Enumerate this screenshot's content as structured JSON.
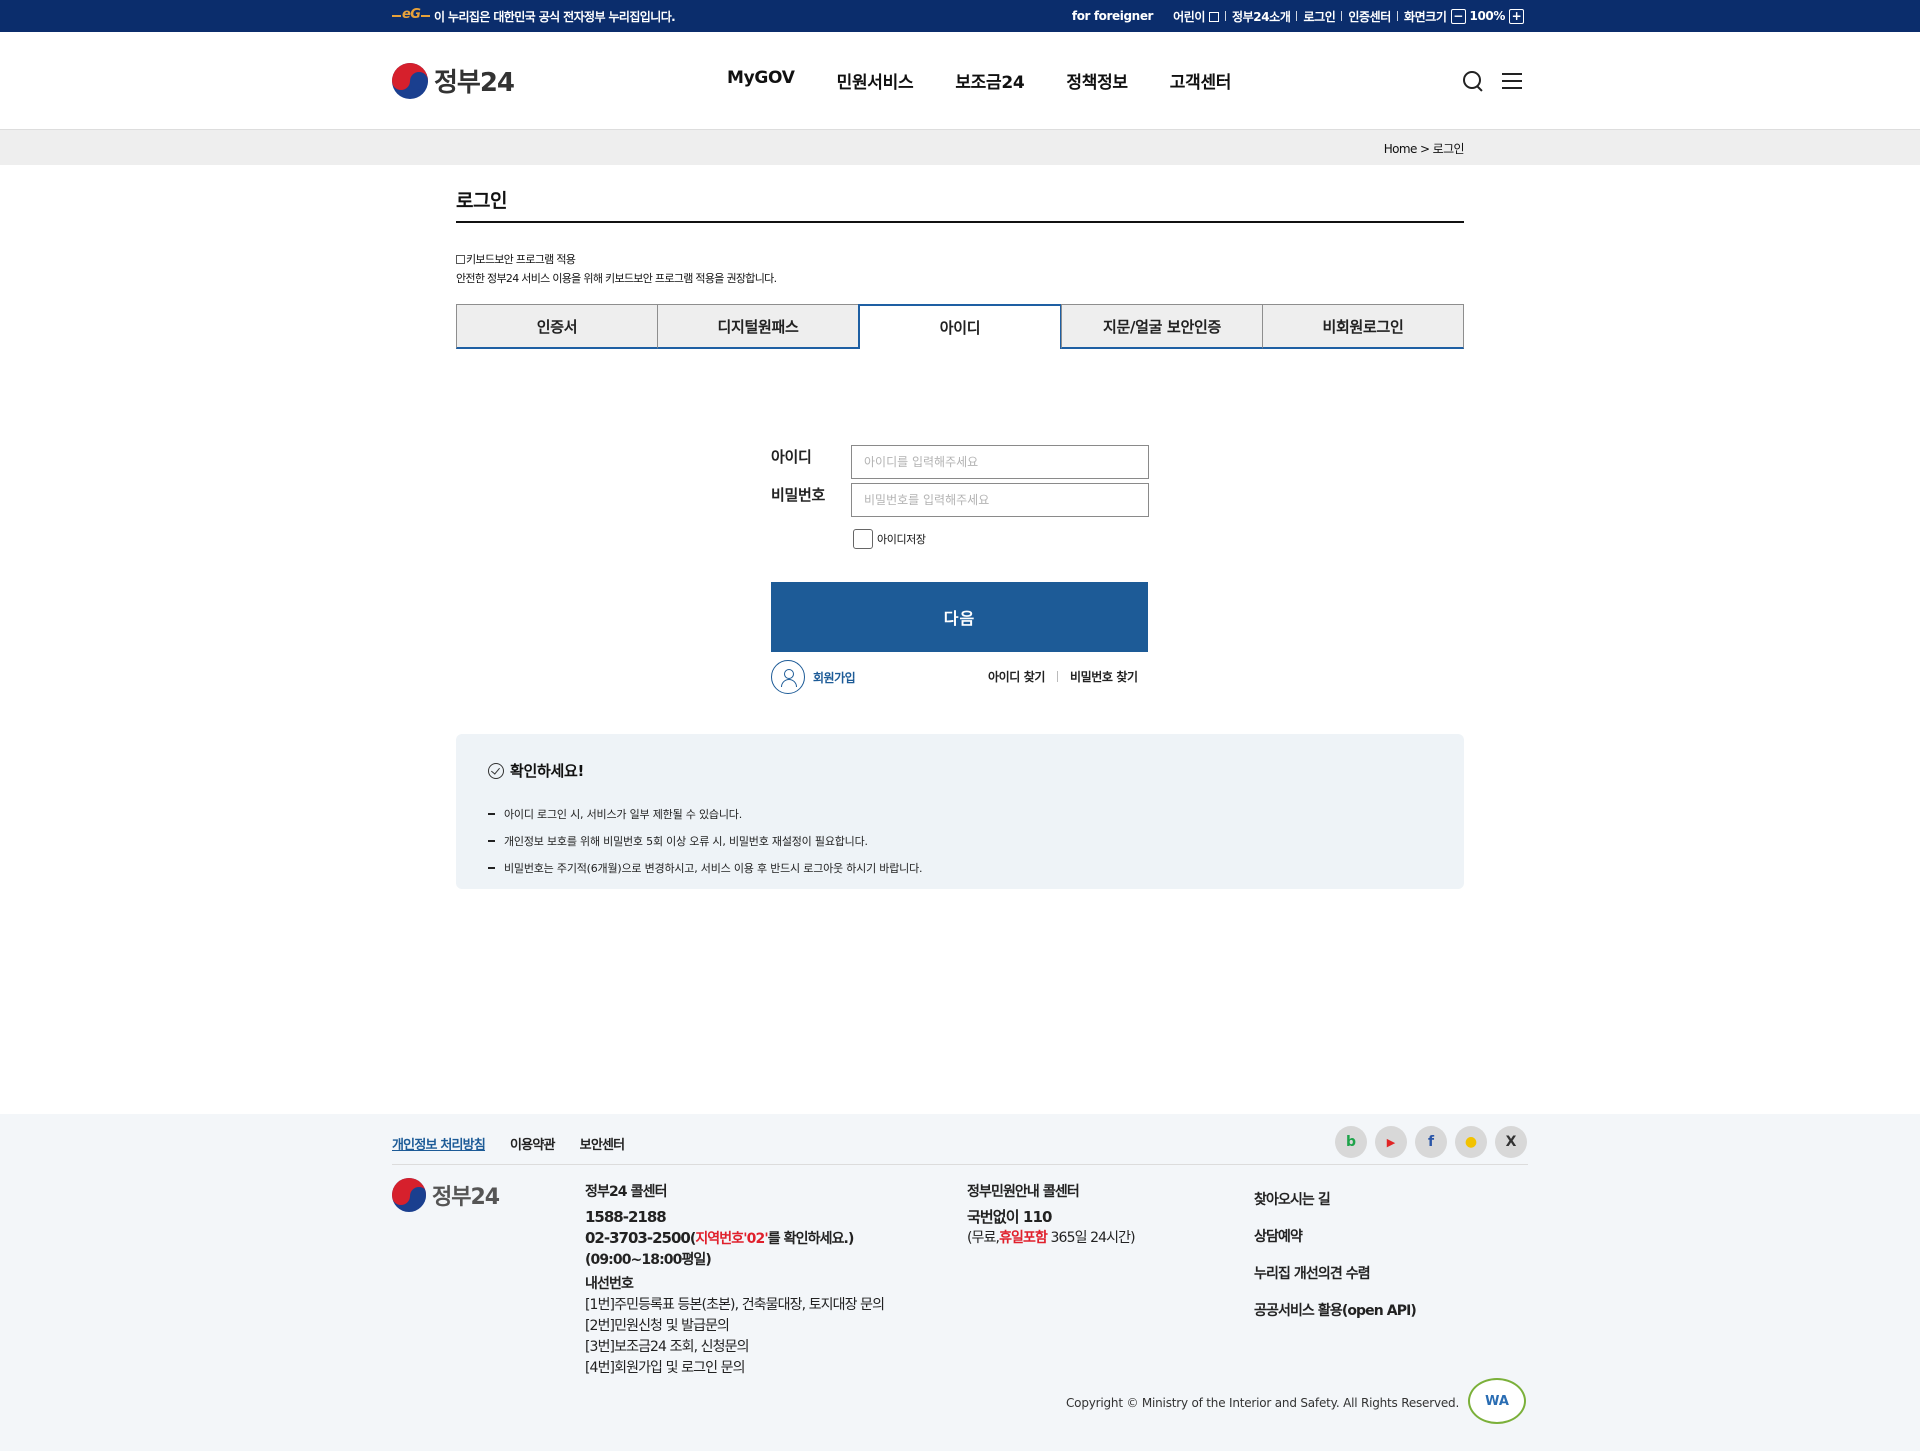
{
  "topbar": {
    "gov_note": "이 누리집은 대한민국 공식 전자정부 누리집입니다.",
    "eg_text": "eG",
    "foreigner": "for foreigner",
    "children": "어린이",
    "intro": "정부24소개",
    "login": "로그인",
    "cert_center": "인증센터",
    "screen_size": "화면크기",
    "zoom_minus": "−",
    "zoom_value": "100%",
    "zoom_plus": "+"
  },
  "header": {
    "brand": "정부24",
    "nav": [
      "MyGOV",
      "민원서비스",
      "보조금24",
      "정책정보",
      "고객센터"
    ]
  },
  "breadcrumb": "Home > 로그인",
  "main": {
    "title": "로그인",
    "kb_security_label": "키보드보안 프로그램 적용",
    "kb_security_note": "안전한 정부24 서비스 이용을 위해 키보드보안 프로그램 적용을 권장합니다.",
    "tabs": [
      "인증서",
      "디지털원패스",
      "아이디",
      "지문/얼굴 보안인증",
      "비회원로그인"
    ],
    "active_tab": "아이디",
    "form": {
      "id_label": "아이디",
      "id_placeholder": "아이디를 입력해주세요",
      "pw_label": "비밀번호",
      "pw_placeholder": "비밀번호를 입력해주세요",
      "save_id": "아이디저장",
      "next_button": "다음",
      "join": "회원가입",
      "find_id": "아이디 찾기",
      "find_pw": "비밀번호 찾기"
    },
    "notice": {
      "title": "확인하세요!",
      "items": [
        "아이디 로그인 시, 서비스가 일부 제한될 수 있습니다.",
        "개인정보 보호를 위해 비밀번호 5회 이상 오류 시, 비밀번호 재설정이 필요합니다.",
        "비밀번호는 주기적(6개월)으로 변경하시고, 서비스 이용 후 반드시 로그아웃 하시기 바랍니다."
      ]
    }
  },
  "footer": {
    "links": [
      "개인정보 처리방침",
      "이용약관",
      "보안센터"
    ],
    "sns": [
      "b",
      "▶",
      "f",
      "●",
      "X"
    ],
    "brand": "정부24",
    "call_center": {
      "title": "정부24 콜센터",
      "phone1": "1588-2188",
      "phone2": "02-3703-2500",
      "phone2_note_pre": "(",
      "phone2_note_red": "지역번호'02'",
      "phone2_note_post": "를 확인하세요.)",
      "hours": "(09:00~18:00평일)",
      "ext_title": "내선번호",
      "ext": [
        "[1번]주민등록표 등본(초본), 건축물대장, 토지대장 문의",
        "[2번]민원신청 및 발급문의",
        "[3번]보조금24 조회, 신청문의",
        "[4번]회원가입 및 로그인 문의"
      ]
    },
    "gov_center": {
      "title": "정부민원안내 콜센터",
      "number": "국번없이 110",
      "note_pre": "(무료,",
      "note_red": "휴일포함",
      "note_post": " 365일 24시간)"
    },
    "quick": [
      "찾아오시는 길",
      "상담예약",
      "누리집 개선의견 수렴",
      "공공서비스 활용(open API)"
    ],
    "copyright": "Copyright © Ministry of the Interior and Safety. All Rights Reserved.",
    "wa": "WA"
  },
  "colors": {
    "topbar": "#0b2d6c",
    "primary": "#1d5b97",
    "accent_red": "#e0202c"
  }
}
